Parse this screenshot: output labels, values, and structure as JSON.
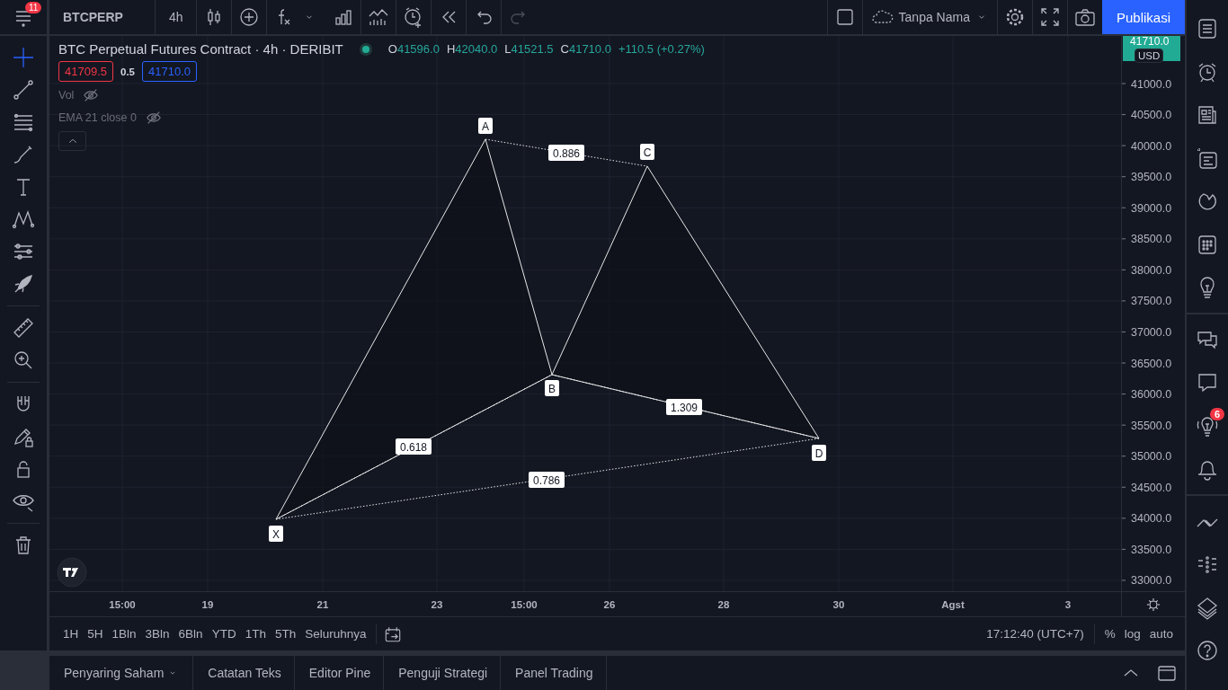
{
  "top_bar": {
    "menu_badge": "11",
    "symbol": "BTCPERP",
    "interval": "4h",
    "tools": [
      {
        "kind": "candles"
      },
      {
        "kind": "compare"
      },
      {
        "kind": "indicators"
      },
      {
        "kind": "chevron"
      },
      {
        "kind": "bars"
      },
      {
        "kind": "templates"
      },
      {
        "kind": "alert"
      },
      {
        "kind": "replay"
      },
      {
        "kind": "undo",
        "disabled": false
      },
      {
        "kind": "redo",
        "disabled": true
      }
    ],
    "layout_name": "Tanpa Nama",
    "publish": "Publikasi"
  },
  "left_toolbar": [
    [
      {
        "kind": "crosshair",
        "selected": true
      },
      {
        "kind": "trendline",
        "selected": false
      },
      {
        "kind": "fib",
        "selected": false
      },
      {
        "kind": "brush",
        "selected": false
      },
      {
        "kind": "text",
        "selected": false
      },
      {
        "kind": "pattern",
        "selected": false
      },
      {
        "kind": "prediction",
        "selected": false
      },
      {
        "kind": "rocket",
        "selected": false
      }
    ],
    [
      {
        "kind": "ruler",
        "selected": false
      },
      {
        "kind": "zoom",
        "selected": false
      }
    ],
    [
      {
        "kind": "magnet",
        "selected": false
      },
      {
        "kind": "drawlock",
        "selected": false
      },
      {
        "kind": "lock",
        "selected": false
      },
      {
        "kind": "eye",
        "selected": false
      }
    ],
    [
      {
        "kind": "trash",
        "selected": false
      }
    ]
  ],
  "legend": {
    "title": "BTC Perpetual Futures Contract · 4h · DERIBIT",
    "ohlc": [
      {
        "key": "O",
        "value": "41596.0"
      },
      {
        "key": "H",
        "value": "42040.0"
      },
      {
        "key": "L",
        "value": "41521.5"
      },
      {
        "key": "C",
        "value": "41710.0"
      }
    ],
    "change": "+110.5 (+0.27%)",
    "bid": "41709.5",
    "spread": "0.5",
    "ask": "41710.0",
    "indicators": [
      {
        "name": "Vol",
        "hidden": true
      },
      {
        "name": "EMA 21 close 0",
        "hidden": true
      }
    ]
  },
  "pattern": {
    "points": [
      {
        "label": "X"
      },
      {
        "label": "A"
      },
      {
        "label": "B"
      },
      {
        "label": "C"
      },
      {
        "label": "D"
      }
    ],
    "ratios": [
      {
        "label": "0.886"
      },
      {
        "label": "0.618"
      },
      {
        "label": "1.309"
      },
      {
        "label": "0.786"
      }
    ]
  },
  "price_axis": {
    "last_price": "41710.0",
    "currency": "USD",
    "ticks": [
      "41000.0",
      "40500.0",
      "40000.0",
      "39500.0",
      "39000.0",
      "38500.0",
      "38000.0",
      "37500.0",
      "37000.0",
      "36500.0",
      "36000.0",
      "35500.0",
      "35000.0",
      "34500.0",
      "34000.0",
      "33500.0",
      "33000.0"
    ]
  },
  "time_axis": [
    "15:00",
    "19",
    "21",
    "23",
    "15:00",
    "26",
    "28",
    "30",
    "Agst",
    "3"
  ],
  "bottom_toolbar": {
    "ranges": [
      "1H",
      "5H",
      "1Bln",
      "3Bln",
      "6Bln",
      "YTD",
      "1Th",
      "5Th",
      "Seluruhnya"
    ],
    "clock": "17:12:40 (UTC+7)",
    "percent": "%",
    "log": "log",
    "auto": "auto"
  },
  "bottom_tabs": [
    {
      "label": "Penyaring Saham",
      "has_menu": true
    },
    {
      "label": "Catatan Teks",
      "has_menu": false
    },
    {
      "label": "Editor Pine",
      "has_menu": false
    },
    {
      "label": "Penguji Strategi",
      "has_menu": false
    },
    {
      "label": "Panel Trading",
      "has_menu": false
    }
  ],
  "right_sidebar": [
    [
      {
        "kind": "watchlist"
      },
      {
        "kind": "alarm"
      },
      {
        "kind": "news"
      },
      {
        "kind": "hotlist"
      },
      {
        "kind": "flame"
      },
      {
        "kind": "calendar"
      },
      {
        "kind": "bulb"
      }
    ],
    [
      {
        "kind": "chats"
      },
      {
        "kind": "chat"
      },
      {
        "kind": "ideas",
        "badge": "6"
      },
      {
        "kind": "bell"
      }
    ],
    [
      {
        "kind": "chevrons"
      },
      {
        "kind": "dots"
      },
      {
        "kind": "layers"
      },
      {
        "kind": "help"
      }
    ]
  ]
}
